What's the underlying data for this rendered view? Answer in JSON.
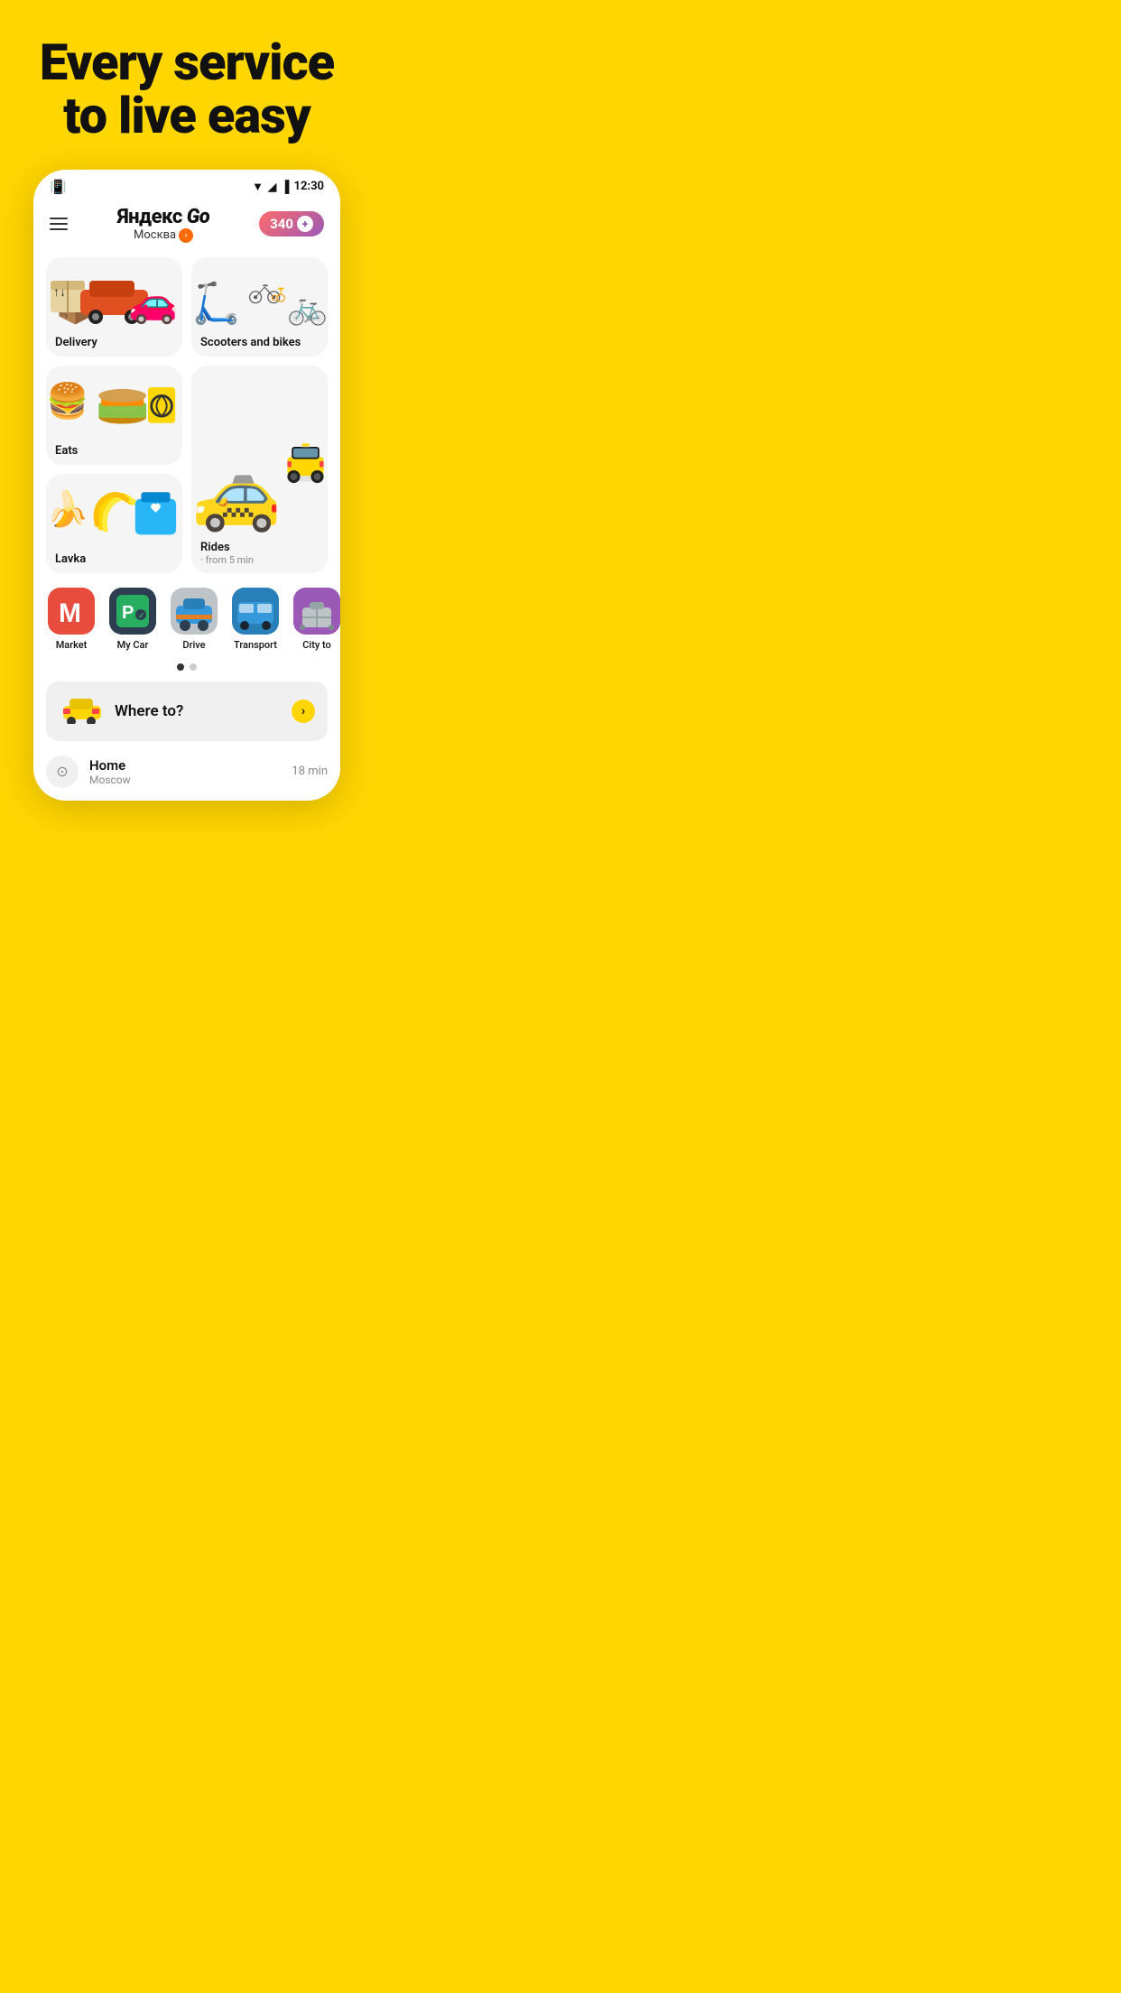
{
  "hero": {
    "title": "Every service to live easy"
  },
  "status_bar": {
    "time": "12:30",
    "vibrate": "📳",
    "wifi": "▼",
    "signal": "◢",
    "battery": "🔋"
  },
  "header": {
    "app_name": "Яндекс",
    "app_go": "Go",
    "city": "Москва",
    "points": "340",
    "menu_label": "Menu"
  },
  "services": [
    {
      "id": "delivery",
      "label": "Delivery",
      "emoji_left": "📦",
      "emoji_right": "🚐",
      "sub": ""
    },
    {
      "id": "scooters",
      "label": "Scooters and bikes",
      "emoji": "🛴",
      "sub": ""
    },
    {
      "id": "eats",
      "label": "Eats",
      "emoji": "🍔",
      "sub": ""
    },
    {
      "id": "rides",
      "label": "Rides",
      "sub": "from 5 min",
      "emoji": "🚕",
      "tall": true
    },
    {
      "id": "lavka",
      "label": "Lavka",
      "emoji": "🍌",
      "sub": ""
    }
  ],
  "mini_services": [
    {
      "id": "market",
      "label": "Market",
      "color": "#E74C3C",
      "emoji": "🅜"
    },
    {
      "id": "my-car",
      "label": "My Car",
      "color": "#2ECC71",
      "emoji": "🅟"
    },
    {
      "id": "drive",
      "label": "Drive",
      "color": "#3498DB",
      "emoji": "🚗"
    },
    {
      "id": "transport",
      "label": "Transport",
      "color": "#2980B9",
      "emoji": "🚌"
    },
    {
      "id": "city-to",
      "label": "City to",
      "color": "#9B59B6",
      "emoji": "🧳"
    }
  ],
  "pagination": {
    "total": 2,
    "active": 0
  },
  "where_to": {
    "placeholder": "Where to?",
    "arrow": "›"
  },
  "recent": [
    {
      "name": "Home",
      "city": "Moscow",
      "time": "18 min"
    }
  ]
}
